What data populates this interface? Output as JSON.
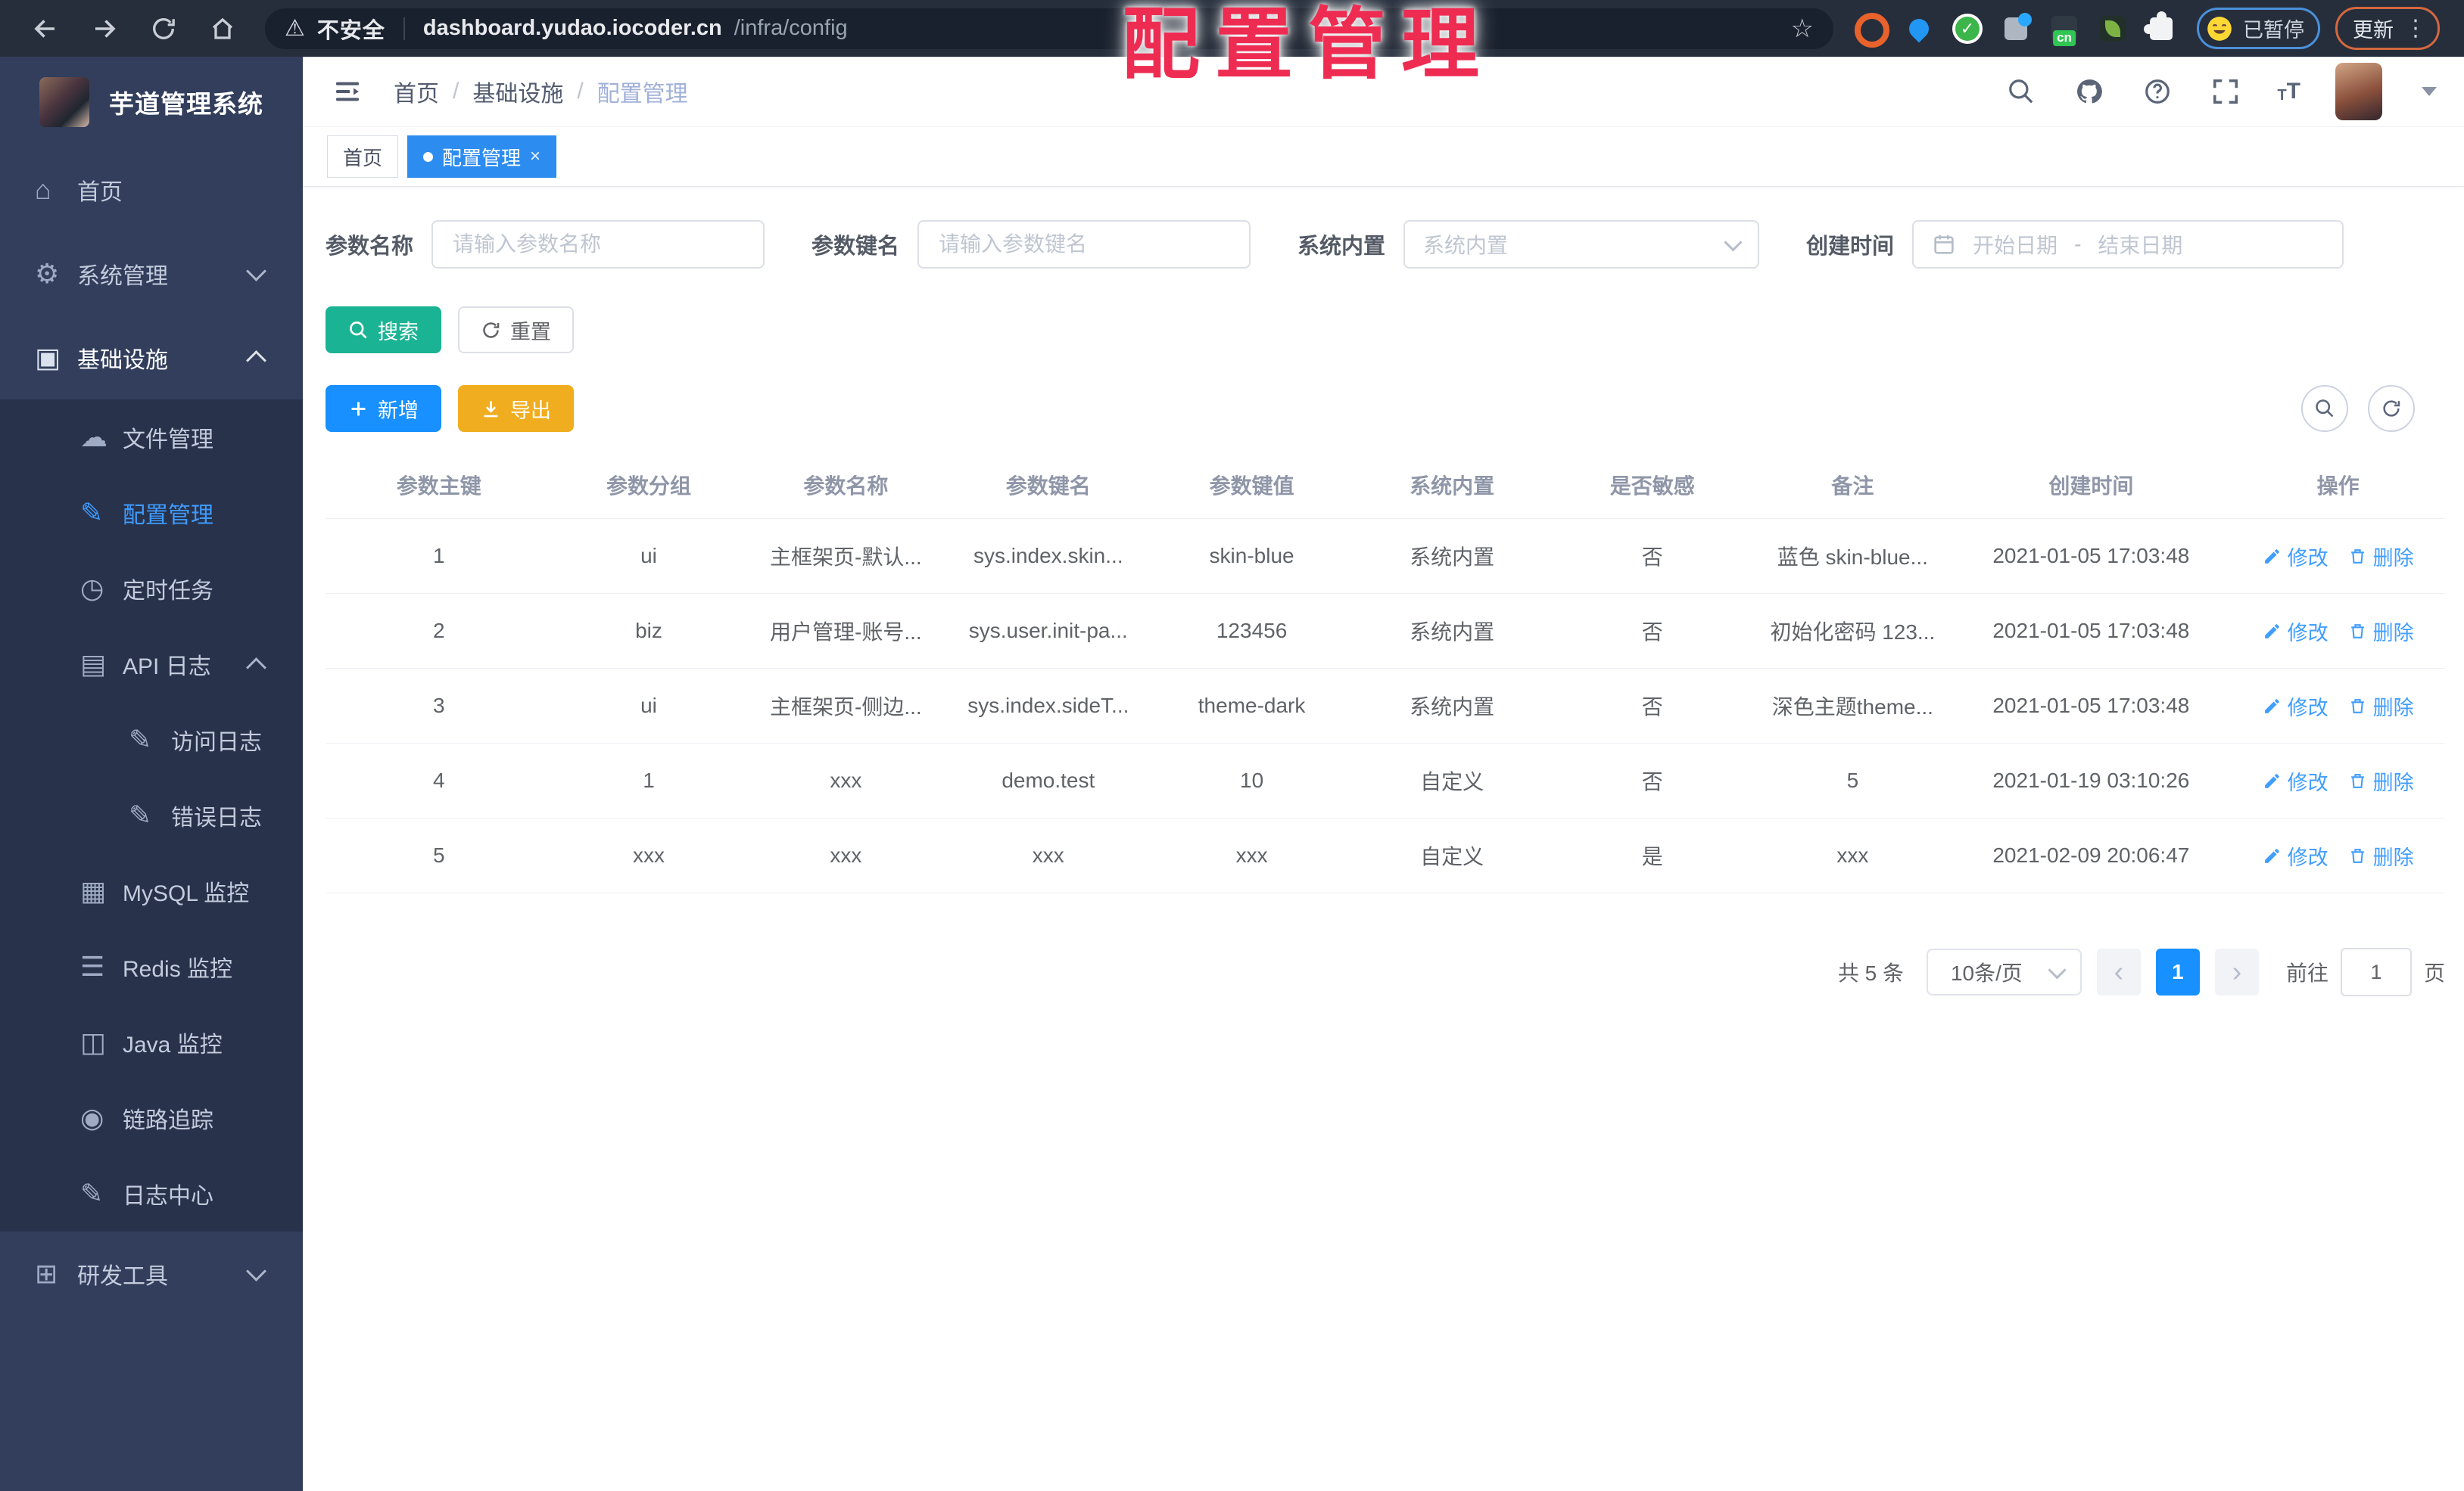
{
  "browser": {
    "security_label": "不安全",
    "url_host": "dashboard.yudao.iocoder.cn",
    "url_path": "/infra/config",
    "star": "☆",
    "paused_badge": "已暂停",
    "update_label": "更新",
    "kebab": "⋮",
    "warning_glyph": "⚠",
    "cn_badge": "cn"
  },
  "overlay_title": "配置管理",
  "sidebar": {
    "title": "芋道管理系统",
    "items": [
      {
        "name": "home",
        "label": "首页",
        "glyph": "⌂",
        "level": 1
      },
      {
        "name": "system-admin",
        "label": "系统管理",
        "glyph": "⚙",
        "level": 1,
        "chevron": "down"
      },
      {
        "name": "infrastructure",
        "label": "基础设施",
        "glyph": "▣",
        "level": 1,
        "chevron": "up",
        "open": true
      },
      {
        "name": "file-manage",
        "label": "文件管理",
        "glyph": "☁",
        "level": 2
      },
      {
        "name": "config-manage",
        "label": "配置管理",
        "glyph": "✎",
        "level": 2,
        "active": true
      },
      {
        "name": "scheduled-jobs",
        "label": "定时任务",
        "glyph": "◷",
        "level": 2
      },
      {
        "name": "api-logs",
        "label": "API 日志",
        "glyph": "▤",
        "level": 2,
        "chevron": "up"
      },
      {
        "name": "access-logs",
        "label": "访问日志",
        "glyph": "✎",
        "level": 3
      },
      {
        "name": "error-logs",
        "label": "错误日志",
        "glyph": "✎",
        "level": 3
      },
      {
        "name": "mysql-monitor",
        "label": "MySQL 监控",
        "glyph": "▦",
        "level": 2
      },
      {
        "name": "redis-monitor",
        "label": "Redis 监控",
        "glyph": "☰",
        "level": 2
      },
      {
        "name": "java-monitor",
        "label": "Java 监控",
        "glyph": "◫",
        "level": 2
      },
      {
        "name": "trace",
        "label": "链路追踪",
        "glyph": "◉",
        "level": 2
      },
      {
        "name": "log-center",
        "label": "日志中心",
        "glyph": "✎",
        "level": 2
      },
      {
        "name": "dev-tools",
        "label": "研发工具",
        "glyph": "⊞",
        "level": 1,
        "chevron": "down"
      }
    ]
  },
  "navbar": {
    "breadcrumb": [
      "首页",
      "基础设施",
      "配置管理"
    ],
    "separator": "/"
  },
  "tabs": [
    {
      "label": "首页"
    },
    {
      "label": "配置管理",
      "close": "×"
    }
  ],
  "filters": {
    "name_label": "参数名称",
    "name_placeholder": "请输入参数名称",
    "key_label": "参数键名",
    "key_placeholder": "请输入参数键名",
    "builtin_label": "系统内置",
    "builtin_placeholder": "系统内置",
    "time_label": "创建时间",
    "start_placeholder": "开始日期",
    "range_separator": "-",
    "end_placeholder": "结束日期"
  },
  "buttons": {
    "search": "搜索",
    "reset": "重置",
    "add": "新增",
    "export": "导出"
  },
  "table": {
    "columns": [
      "参数主键",
      "参数分组",
      "参数名称",
      "参数键名",
      "参数键值",
      "系统内置",
      "是否敏感",
      "备注",
      "创建时间",
      "操作"
    ],
    "rows": [
      {
        "id": "1",
        "group": "ui",
        "name": "主框架页-默认...",
        "key": "sys.index.skin...",
        "value": "skin-blue",
        "builtin": "系统内置",
        "sensitive": "否",
        "remark": "蓝色 skin-blue...",
        "created": "2021-01-05 17:03:48"
      },
      {
        "id": "2",
        "group": "biz",
        "name": "用户管理-账号...",
        "key": "sys.user.init-pa...",
        "value": "123456",
        "builtin": "系统内置",
        "sensitive": "否",
        "remark": "初始化密码 123...",
        "created": "2021-01-05 17:03:48"
      },
      {
        "id": "3",
        "group": "ui",
        "name": "主框架页-侧边...",
        "key": "sys.index.sideT...",
        "value": "theme-dark",
        "builtin": "系统内置",
        "sensitive": "否",
        "remark": "深色主题theme...",
        "created": "2021-01-05 17:03:48"
      },
      {
        "id": "4",
        "group": "1",
        "name": "xxx",
        "key": "demo.test",
        "value": "10",
        "builtin": "自定义",
        "sensitive": "否",
        "remark": "5",
        "created": "2021-01-19 03:10:26"
      },
      {
        "id": "5",
        "group": "xxx",
        "name": "xxx",
        "key": "xxx",
        "value": "xxx",
        "builtin": "自定义",
        "sensitive": "是",
        "remark": "xxx",
        "created": "2021-02-09 20:06:47"
      }
    ],
    "edit_label": "修改",
    "delete_label": "删除"
  },
  "pagination": {
    "total": "共 5 条",
    "page_size": "10条/页",
    "prev": "‹",
    "next": "›",
    "current_page": "1",
    "goto_label": "前往",
    "goto_value": "1",
    "page_unit": "页"
  },
  "colors": {
    "accent_blue": "#1890ff",
    "tab_active": "#2d8cf0",
    "teal": "#1ab394",
    "warning_yellow": "#f0ad1f",
    "overlay_red": "#ee2c52",
    "sidebar_bg": "#323e5c"
  }
}
